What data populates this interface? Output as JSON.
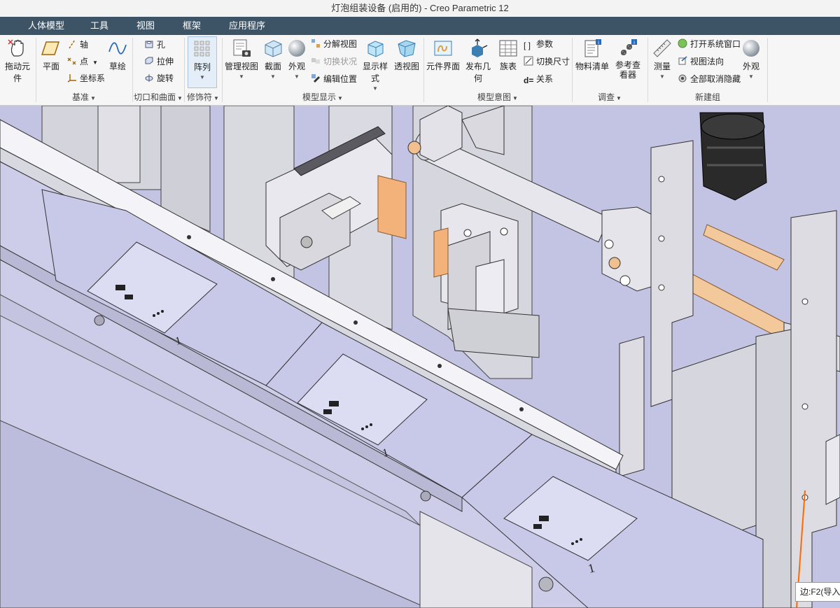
{
  "window": {
    "title": "灯泡组装设备 (启用的) - Creo Parametric 12"
  },
  "menu": {
    "tabs": [
      "人体模型",
      "工具",
      "视图",
      "框架",
      "应用程序"
    ]
  },
  "ribbon": {
    "drag": {
      "label": "拖动元件"
    },
    "datum": {
      "group_label": "基准",
      "plane": "平面",
      "axis": "轴",
      "point": "点",
      "csys": "坐标系",
      "sketch": "草绘"
    },
    "cut_surface": {
      "group_label": "切口和曲面",
      "hole": "孔",
      "extrude": "拉伸",
      "revolve": "旋转"
    },
    "modifiers": {
      "group_label": "修饰符",
      "pattern": "阵列"
    },
    "model_display": {
      "group_label": "模型显示",
      "manage_views": "管理视图",
      "section": "截面",
      "appearance": "外观",
      "explode_view": "分解视图",
      "toggle_status": "切换状况",
      "edit_position": "编辑位置",
      "display_style": "显示样式",
      "perspective": "透视图"
    },
    "model_intent": {
      "group_label": "模型意图",
      "component_interface": "元件界面",
      "publish_geometry": "发布几何",
      "family_table": "族表",
      "parameters": "参数",
      "switch_dimensions": "切换尺寸",
      "relations": "关系"
    },
    "investigate": {
      "group_label": "调查",
      "bom": "物料清单",
      "ref_viewer": "参考查看器"
    },
    "new_group": {
      "group_label": "新建组",
      "measure": "测量",
      "open_system_window": "打开系统窗口",
      "view_normal": "视图法向",
      "unhide_all": "全部取消隐藏",
      "appearance": "外观"
    }
  },
  "viewport": {
    "background": "#c3c3e4",
    "plate_marks": [
      "1",
      "1",
      "1"
    ]
  },
  "status": {
    "tip": "边:F2(导入特"
  }
}
